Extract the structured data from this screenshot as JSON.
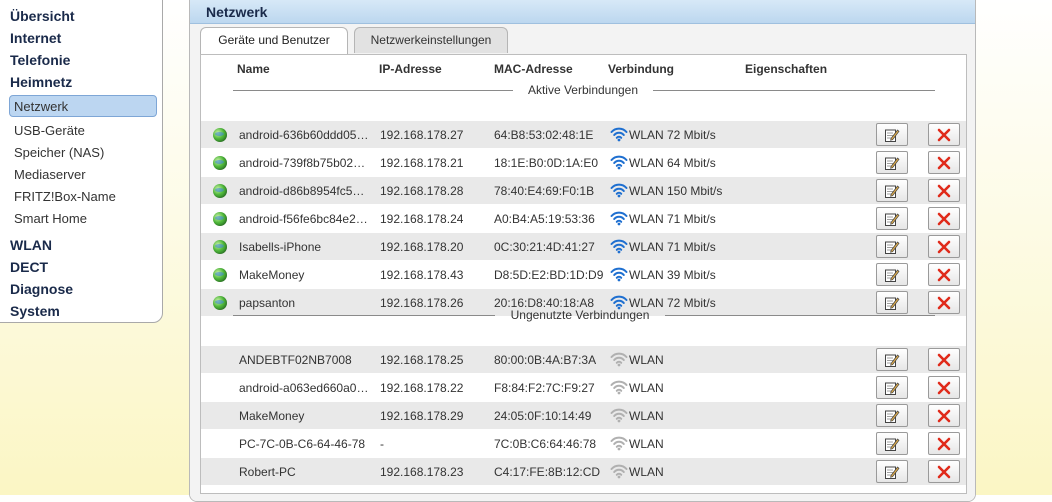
{
  "sidebar": {
    "items": [
      {
        "label": "Übersicht",
        "level": "main"
      },
      {
        "label": "Internet",
        "level": "main"
      },
      {
        "label": "Telefonie",
        "level": "main"
      },
      {
        "label": "Heimnetz",
        "level": "main"
      },
      {
        "label": "Netzwerk",
        "level": "sub",
        "active": true
      },
      {
        "label": "USB-Geräte",
        "level": "sub"
      },
      {
        "label": "Speicher (NAS)",
        "level": "sub"
      },
      {
        "label": "Mediaserver",
        "level": "sub"
      },
      {
        "label": "FRITZ!Box-Name",
        "level": "sub"
      },
      {
        "label": "Smart Home",
        "level": "sub"
      },
      {
        "label": "WLAN",
        "level": "main"
      },
      {
        "label": "DECT",
        "level": "main"
      },
      {
        "label": "Diagnose",
        "level": "main"
      },
      {
        "label": "System",
        "level": "main"
      }
    ]
  },
  "panel": {
    "title": "Netzwerk",
    "tabs": [
      {
        "label": "Geräte und Benutzer",
        "active": true
      },
      {
        "label": "Netzwerkeinstellungen",
        "active": false
      }
    ]
  },
  "table": {
    "headers": {
      "name": "Name",
      "ip": "IP-Adresse",
      "mac": "MAC-Adresse",
      "connection": "Verbindung",
      "properties": "Eigenschaften"
    },
    "active_label": "Aktive Verbindungen",
    "unused_label": "Ungenutzte Verbindungen",
    "active_rows": [
      {
        "name": "android-636b60ddd05…",
        "ip": "192.168.178.27",
        "mac": "64:B8:53:02:48:1E",
        "connection": "WLAN 72 Mbit/s"
      },
      {
        "name": "android-739f8b75b02…",
        "ip": "192.168.178.21",
        "mac": "18:1E:B0:0D:1A:E0",
        "connection": "WLAN 64 Mbit/s"
      },
      {
        "name": "android-d86b8954fc5…",
        "ip": "192.168.178.28",
        "mac": "78:40:E4:69:F0:1B",
        "connection": "WLAN 150 Mbit/s"
      },
      {
        "name": "android-f56fe6bc84e2…",
        "ip": "192.168.178.24",
        "mac": "A0:B4:A5:19:53:36",
        "connection": "WLAN 71 Mbit/s"
      },
      {
        "name": "Isabells-iPhone",
        "ip": "192.168.178.20",
        "mac": "0C:30:21:4D:41:27",
        "connection": "WLAN 71 Mbit/s"
      },
      {
        "name": "MakeMoney",
        "ip": "192.168.178.43",
        "mac": "D8:5D:E2:BD:1D:D9",
        "connection": "WLAN 39 Mbit/s"
      },
      {
        "name": "papsanton",
        "ip": "192.168.178.26",
        "mac": "20:16:D8:40:18:A8",
        "connection": "WLAN 72 Mbit/s"
      }
    ],
    "unused_rows": [
      {
        "name": "ANDEBTF02NB7008",
        "ip": "192.168.178.25",
        "mac": "80:00:0B:4A:B7:3A",
        "connection": "WLAN"
      },
      {
        "name": "android-a063ed660a0…",
        "ip": "192.168.178.22",
        "mac": "F8:84:F2:7C:F9:27",
        "connection": "WLAN"
      },
      {
        "name": "MakeMoney",
        "ip": "192.168.178.29",
        "mac": "24:05:0F:10:14:49",
        "connection": "WLAN"
      },
      {
        "name": "PC-7C-0B-C6-64-46-78",
        "ip": "-",
        "mac": "7C:0B:C6:64:46:78",
        "connection": "WLAN"
      },
      {
        "name": "Robert-PC",
        "ip": "192.168.178.23",
        "mac": "C4:17:FE:8B:12:CD",
        "connection": "WLAN"
      }
    ]
  },
  "colors": {
    "wifi_active": "#1e6fd0",
    "wifi_inactive": "#b0b0b0",
    "delete_red": "#e02a1a",
    "sidebar_active_bg": "#bcd6f1"
  }
}
